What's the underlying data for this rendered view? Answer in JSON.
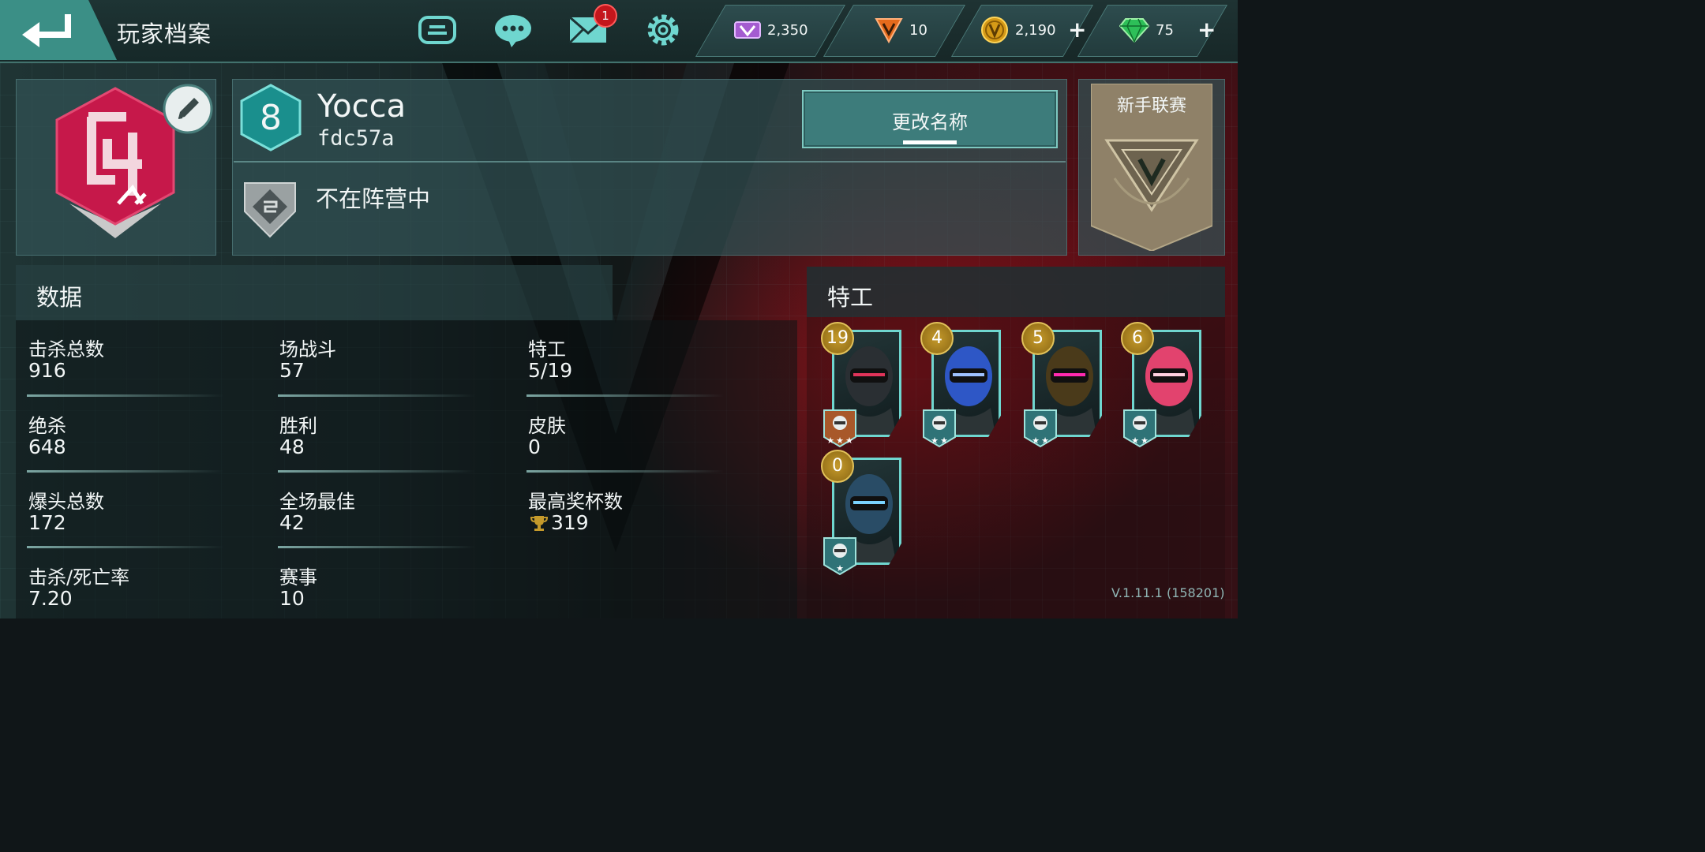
{
  "header": {
    "title": "玩家档案",
    "mail_badge": "1",
    "icons": [
      "back-arrow-icon",
      "gameloft-icon",
      "chat-icon",
      "mail-icon",
      "settings-gear-icon"
    ]
  },
  "currencies": [
    {
      "id": "credits",
      "icon": "purple-v-credit-icon",
      "value": "2,350",
      "addable": false
    },
    {
      "id": "vpoints",
      "icon": "orange-v-icon",
      "value": "10",
      "addable": false
    },
    {
      "id": "gold",
      "icon": "gold-coin-icon",
      "value": "2,190",
      "addable": true,
      "add_label": "+"
    },
    {
      "id": "gems",
      "icon": "green-gem-icon",
      "value": "75",
      "addable": true,
      "add_label": "+"
    }
  ],
  "profile": {
    "level": "8",
    "name": "Yocca",
    "player_id": "fdc57a",
    "rename_label": "更改名称",
    "faction_status": "不在阵营中",
    "league": "新手联赛"
  },
  "stats": {
    "title": "数据",
    "columns": [
      [
        {
          "label": "击杀总数",
          "value": "916"
        },
        {
          "label": "绝杀",
          "value": "648"
        },
        {
          "label": "爆头总数",
          "value": "172"
        },
        {
          "label": "击杀/死亡率",
          "value": "7.20"
        }
      ],
      [
        {
          "label": "场战斗",
          "value": "57"
        },
        {
          "label": "胜利",
          "value": "48"
        },
        {
          "label": "全场最佳",
          "value": "42"
        },
        {
          "label": "赛事",
          "value": "10"
        }
      ],
      [
        {
          "label": "特工",
          "value": "5/19"
        },
        {
          "label": "皮肤",
          "value": "0"
        },
        {
          "label": "最高奖杯数",
          "value": "319",
          "icon": "trophy-icon"
        }
      ]
    ]
  },
  "agents": {
    "title": "特工",
    "list": [
      {
        "level": "19",
        "stars": 3,
        "rank_color": "#a8582a"
      },
      {
        "level": "4",
        "stars": 2,
        "rank_color": "#2f7377"
      },
      {
        "level": "5",
        "stars": 2,
        "rank_color": "#2f7377"
      },
      {
        "level": "6",
        "stars": 2,
        "rank_color": "#2f7377"
      },
      {
        "level": "0",
        "stars": 1,
        "rank_color": "#2f7377"
      }
    ]
  },
  "version": "V.1.11.1 (158201)",
  "colors": {
    "accent": "#3b8f86",
    "gold": "#c59a2b",
    "danger": "#c4161c",
    "teal_border": "#6fd6cf"
  }
}
